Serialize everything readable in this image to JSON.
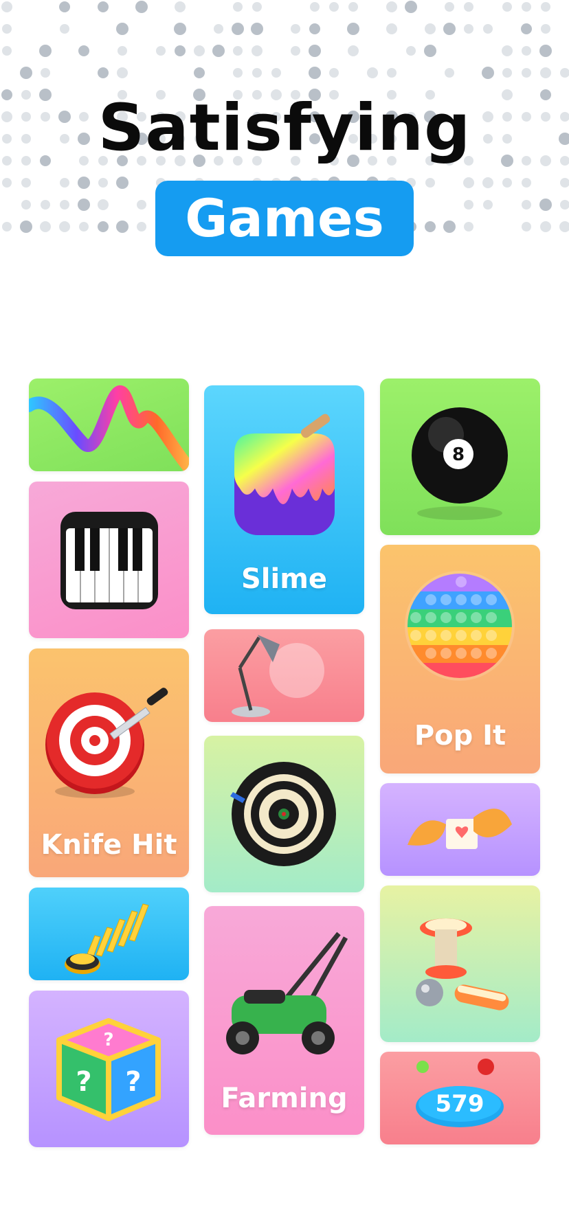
{
  "header": {
    "title": "Satisfying",
    "badge_text": "Games",
    "badge_color": "#159cf1"
  },
  "games": [
    {
      "id": "ribbon",
      "label": "",
      "icon": "ribbon-icon",
      "colors": [
        "#9cf06a",
        "#7fe05a"
      ]
    },
    {
      "id": "piano",
      "label": "",
      "icon": "piano-icon",
      "colors": [
        "#f7a9d8",
        "#fb8fc8"
      ]
    },
    {
      "id": "knife-hit",
      "label": "Knife Hit",
      "icon": "target-knife-icon",
      "colors": [
        "#fbc36d",
        "#f9a779"
      ]
    },
    {
      "id": "domino",
      "label": "",
      "icon": "domino-icon",
      "colors": [
        "#4fd0fb",
        "#1fb2f3"
      ]
    },
    {
      "id": "mystery-box",
      "label": "",
      "icon": "mystery-cube-icon",
      "colors": [
        "#d4b3ff",
        "#b692ff"
      ]
    },
    {
      "id": "slime",
      "label": "Slime",
      "icon": "slime-icon",
      "colors": [
        "#5cd6fd",
        "#1fb2f3"
      ]
    },
    {
      "id": "lamp",
      "label": "",
      "icon": "desk-lamp-icon",
      "colors": [
        "#fb9ea2",
        "#f87f8c"
      ]
    },
    {
      "id": "darts",
      "label": "",
      "icon": "dartboard-icon",
      "colors": [
        "#d7f2a3",
        "#a3ebc8"
      ]
    },
    {
      "id": "farming",
      "label": "Farming",
      "icon": "lawn-mower-icon",
      "colors": [
        "#f8a9d8",
        "#fb8fc8"
      ]
    },
    {
      "id": "eight-ball",
      "label": "",
      "icon": "eight-ball-icon",
      "colors": [
        "#9cf06a",
        "#7fe05a"
      ]
    },
    {
      "id": "pop-it",
      "label": "Pop It",
      "icon": "pop-it-icon",
      "colors": [
        "#fbc46c",
        "#f9a779"
      ]
    },
    {
      "id": "fortune-cookie",
      "label": "",
      "icon": "fortune-cookie-icon",
      "colors": [
        "#d5b3ff",
        "#b692ff"
      ]
    },
    {
      "id": "pinball",
      "label": "",
      "icon": "pinball-icon",
      "colors": [
        "#e7f2a3",
        "#a3ebc8"
      ]
    },
    {
      "id": "counter",
      "label": "",
      "icon": "counter-disc-icon",
      "colors": [
        "#fb9ea2",
        "#f87f8c"
      ],
      "counter_value": "579"
    }
  ],
  "eight_ball_number": "8"
}
